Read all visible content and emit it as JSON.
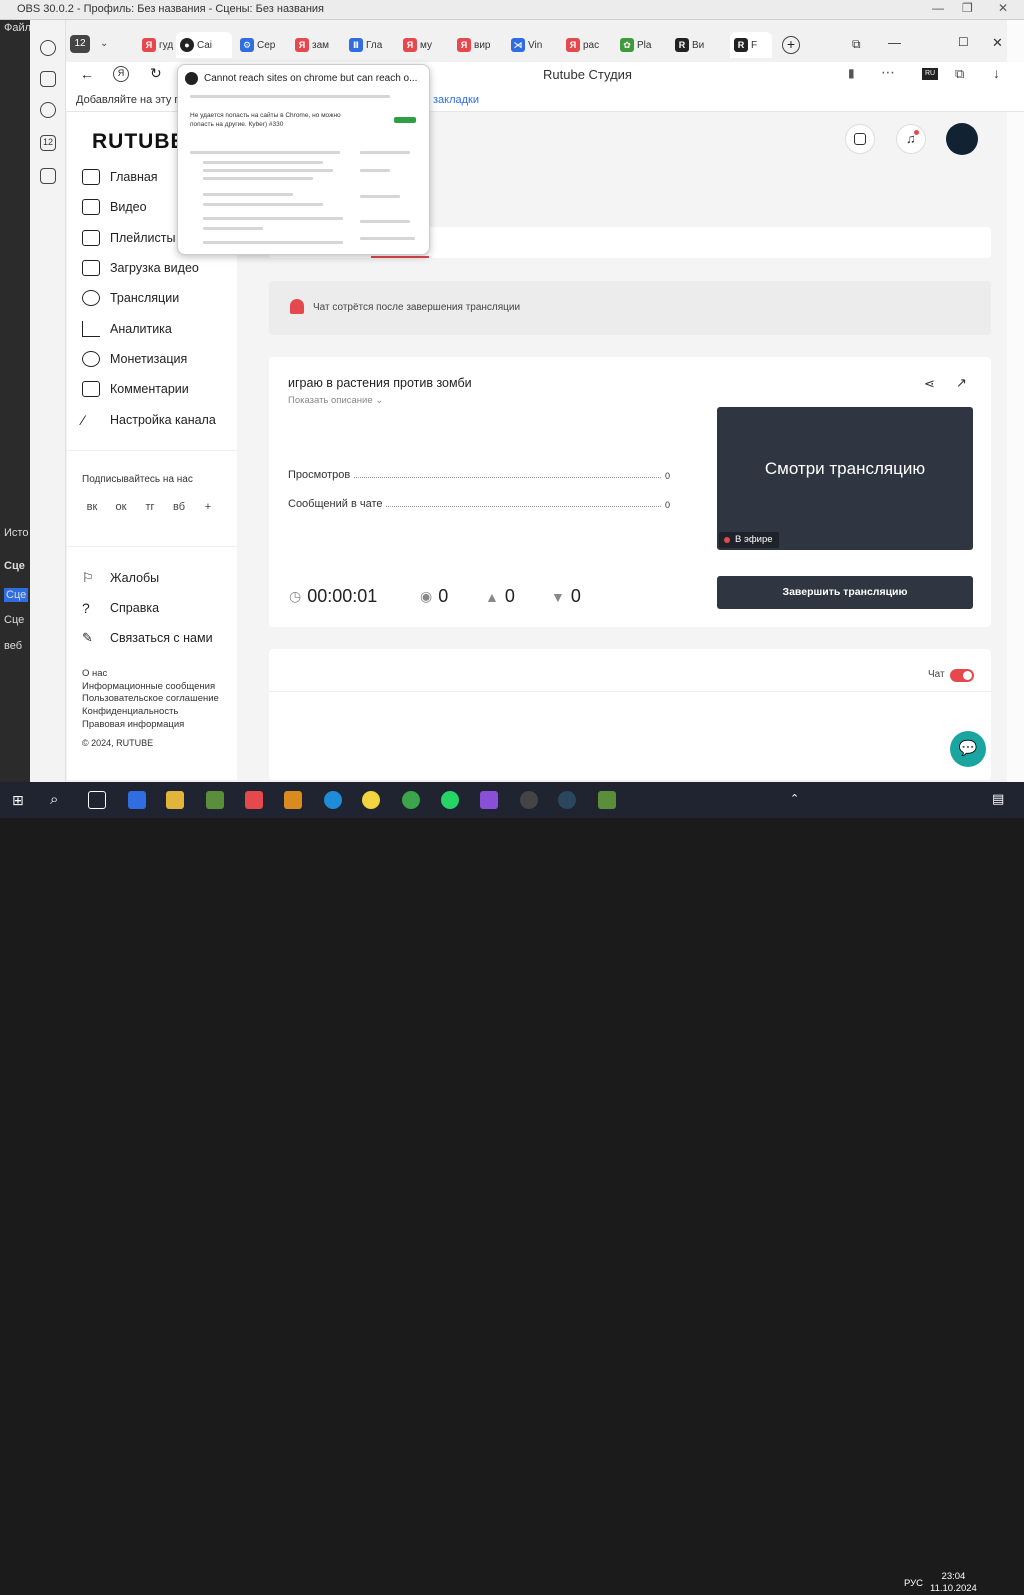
{
  "obs": {
    "title": "OBS 30.0.2 - Профиль: Без названия - Сцены: Без названия",
    "menu_file": "Файл",
    "side_texts": [
      "Исто",
      "Сце",
      "Сце",
      "Сце",
      "веб"
    ]
  },
  "browser": {
    "tab_count": "12",
    "tabs": [
      {
        "label": "гуд",
        "icon": "yandex-icon",
        "color": "#e5484d"
      },
      {
        "label": "Cai",
        "icon": "github-icon",
        "color": "#222"
      },
      {
        "label": "Сер",
        "icon": "settings-icon",
        "color": "#2f6de1"
      },
      {
        "label": "зам",
        "icon": "yandex-icon",
        "color": "#e5484d"
      },
      {
        "label": "Гла",
        "icon": "pause-icon",
        "color": "#2f6de1"
      },
      {
        "label": "му",
        "icon": "yandex-icon",
        "color": "#e5484d"
      },
      {
        "label": "вир",
        "icon": "yandex-icon",
        "color": "#e5484d"
      },
      {
        "label": "Vin",
        "icon": "vscode-icon",
        "color": "#2f6de1"
      },
      {
        "label": "рас",
        "icon": "yandex-icon",
        "color": "#e5484d"
      },
      {
        "label": "Pla",
        "icon": "plants-icon",
        "color": "#3f9a3a"
      },
      {
        "label": "Ви",
        "icon": "rutube-icon",
        "color": "#222"
      },
      {
        "label": "F",
        "icon": "rutube-icon",
        "color": "#222"
      }
    ],
    "page_title": "Rutube Студия",
    "bookmark_hint": "Добавляйте на эту пане",
    "bookmark_link": "закладки"
  },
  "sidebar": {
    "logo": "RUTUBE",
    "items": [
      {
        "label": "Главная",
        "icon": "home-icon"
      },
      {
        "label": "Видео",
        "icon": "video-icon"
      },
      {
        "label": "Плейлисты",
        "icon": "playlist-icon"
      },
      {
        "label": "Загрузка видео",
        "icon": "upload-icon"
      },
      {
        "label": "Трансляции",
        "icon": "broadcast-icon"
      },
      {
        "label": "Аналитика",
        "icon": "analytics-icon"
      },
      {
        "label": "Монетизация",
        "icon": "money-icon"
      },
      {
        "label": "Комментарии",
        "icon": "comment-icon"
      },
      {
        "label": "Настройка канала",
        "icon": "wand-icon"
      }
    ],
    "subscribe_title": "Подписывайтесь на нас",
    "socials": [
      "вк",
      "ок",
      "тг",
      "вб",
      "+"
    ],
    "bottom_items": [
      {
        "label": "Жалобы",
        "icon": "flag-icon"
      },
      {
        "label": "Справка",
        "icon": "question-icon"
      },
      {
        "label": "Связаться с нами",
        "icon": "pencil-icon"
      }
    ],
    "footer_links": [
      "О нас",
      "Информационные сообщения",
      "Пользовательское соглашение",
      "Конфиденциальность",
      "Правовая информация"
    ],
    "copyright": "© 2024, RUTUBE"
  },
  "notice": {
    "text": "Чат сотрётся после завершения трансляции"
  },
  "stream": {
    "title": "играю в растения против зомби",
    "show_description": "Показать описание",
    "views_label": "Просмотров",
    "views_value": "0",
    "messages_label": "Сообщений в чате",
    "messages_value": "0",
    "preview_text": "Смотри трансляцию",
    "live_badge": "В эфире",
    "end_button": "Завершить трансляцию",
    "timer": "00:00:01",
    "viewers": "0",
    "likes": "0",
    "dislikes": "0"
  },
  "chat": {
    "label": "Чат",
    "enabled": true
  },
  "popup": {
    "heading": "Cannot reach sites on chrome but can reach o...",
    "question": "Не удается попасть на сайты в Chrome, но можно попасть на другие. Кyber) #330"
  },
  "taskbar": {
    "lang": "РУС",
    "time": "23:04",
    "date": "11.10.2024"
  }
}
